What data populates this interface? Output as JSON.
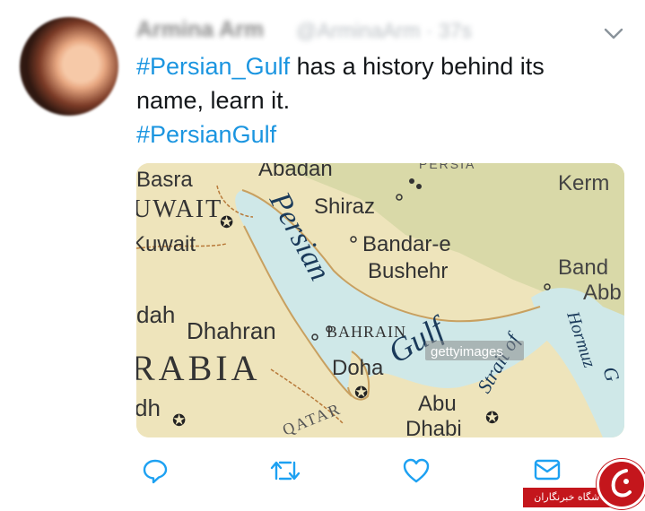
{
  "tweet": {
    "author_name": "Armina Arm",
    "author_handle": "@ArminaArm · 37s",
    "hashtag_main": "#Persian_Gulf",
    "text_rest_line1": " has a history behind its",
    "text_line2": "name, learn it.",
    "hashtag_second": "#PersianGulf"
  },
  "map": {
    "labels": {
      "basra": "Basra",
      "abadan": "Abadan",
      "kerm": "Kerm",
      "kuwait_country": "UWAIT",
      "kuwait_city": "Kuwait",
      "shiraz": "Shiraz",
      "bandar_e": "Bandar-e",
      "bushehr": "Bushehr",
      "band": "Band",
      "abb": "Abb",
      "persian": "Persian",
      "gulf": "Gulf",
      "dah": "dah",
      "dhahran": "Dhahran",
      "bahrain": "BAHRAIN",
      "arabia": "RABIA",
      "doha": "Doha",
      "dh": "dh",
      "qatar": "QATAR",
      "abu": "Abu",
      "dhabi": "Dhabi",
      "strait_of": "Strait of",
      "hormuz": "Hormuz",
      "g": "G",
      "watermark": "gettyimages",
      "top_cut": "PERSIA"
    }
  },
  "badge": {
    "text": "باشگاه خبرنگاران"
  },
  "colors": {
    "link": "#1b95e0",
    "action_icon": "#1da1f2",
    "text": "#14171a"
  }
}
